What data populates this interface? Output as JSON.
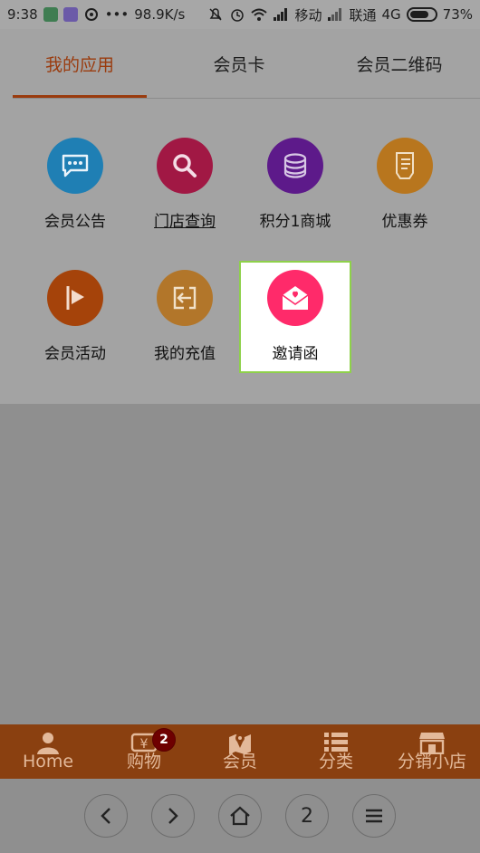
{
  "status_bar": {
    "time": "9:38",
    "net_speed": "98.9K/s",
    "carrier1": "移动",
    "carrier2": "联通",
    "network": "4G",
    "battery": "73%"
  },
  "tabs": [
    {
      "label": "我的应用",
      "active": true
    },
    {
      "label": "会员卡",
      "active": false
    },
    {
      "label": "会员二维码",
      "active": false
    }
  ],
  "apps": [
    {
      "label": "会员公告",
      "icon": "chat-icon",
      "color": "#1f7fb4"
    },
    {
      "label": "门店查询",
      "icon": "search-icon",
      "color": "#a11844"
    },
    {
      "label": "积分1商城",
      "icon": "coins-icon",
      "color": "#5d1a8a"
    },
    {
      "label": "优惠券",
      "icon": "coupon-icon",
      "color": "#b8761e"
    },
    {
      "label": "会员活动",
      "icon": "flag-icon",
      "color": "#a5430a"
    },
    {
      "label": "我的充值",
      "icon": "recharge-icon",
      "color": "#b2762a"
    },
    {
      "label": "邀请函",
      "icon": "invitation-icon",
      "color": "#ff2a6a"
    }
  ],
  "bottom_nav": [
    {
      "label": "Home",
      "icon": "person-icon"
    },
    {
      "label": "购物",
      "icon": "cart-icon",
      "badge": "2"
    },
    {
      "label": "会员",
      "icon": "map-icon"
    },
    {
      "label": "分类",
      "icon": "list-icon"
    },
    {
      "label": "分销小店",
      "icon": "store-icon"
    }
  ],
  "browser": {
    "back": "back-icon",
    "forward": "forward-icon",
    "home": "home-icon",
    "tabs_count": "2",
    "menu": "menu-icon"
  }
}
